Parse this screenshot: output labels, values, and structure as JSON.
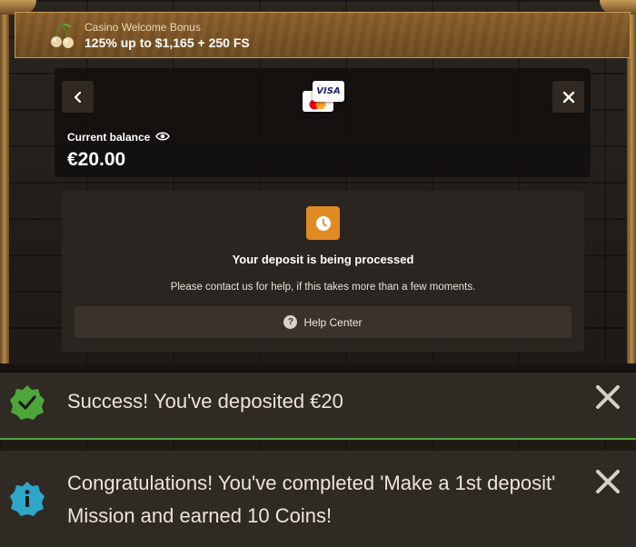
{
  "banner": {
    "subtitle": "Casino Welcome Bonus",
    "title": "125% up to $1,165 + 250 FS",
    "icon": "cherry-icon"
  },
  "deposit_panel": {
    "payment_icons": [
      "mastercard-icon",
      "visa-icon"
    ],
    "visa_label": "VISA",
    "balance_label": "Current balance",
    "balance_value": "€20.00"
  },
  "processing": {
    "icon": "clock-icon",
    "title": "Your deposit is being processed",
    "message": "Please contact us for help, if this takes more than a few moments.",
    "help_label": "Help Center"
  },
  "notifications": [
    {
      "type": "success",
      "icon": "checkmark-badge-icon",
      "text": "Success! You've deposited €20",
      "accent": "#4ea63a"
    },
    {
      "type": "info",
      "icon": "info-badge-icon",
      "text": "Congratulations! You've completed 'Make a 1st deposit' Mission and earned 10 Coins!",
      "accent": "#2fa6c9"
    }
  ],
  "colors": {
    "clock_accent": "#e08a24",
    "banner_border": "#c79a57",
    "success_green": "#4ea63a",
    "info_blue": "#2fa6c9"
  }
}
